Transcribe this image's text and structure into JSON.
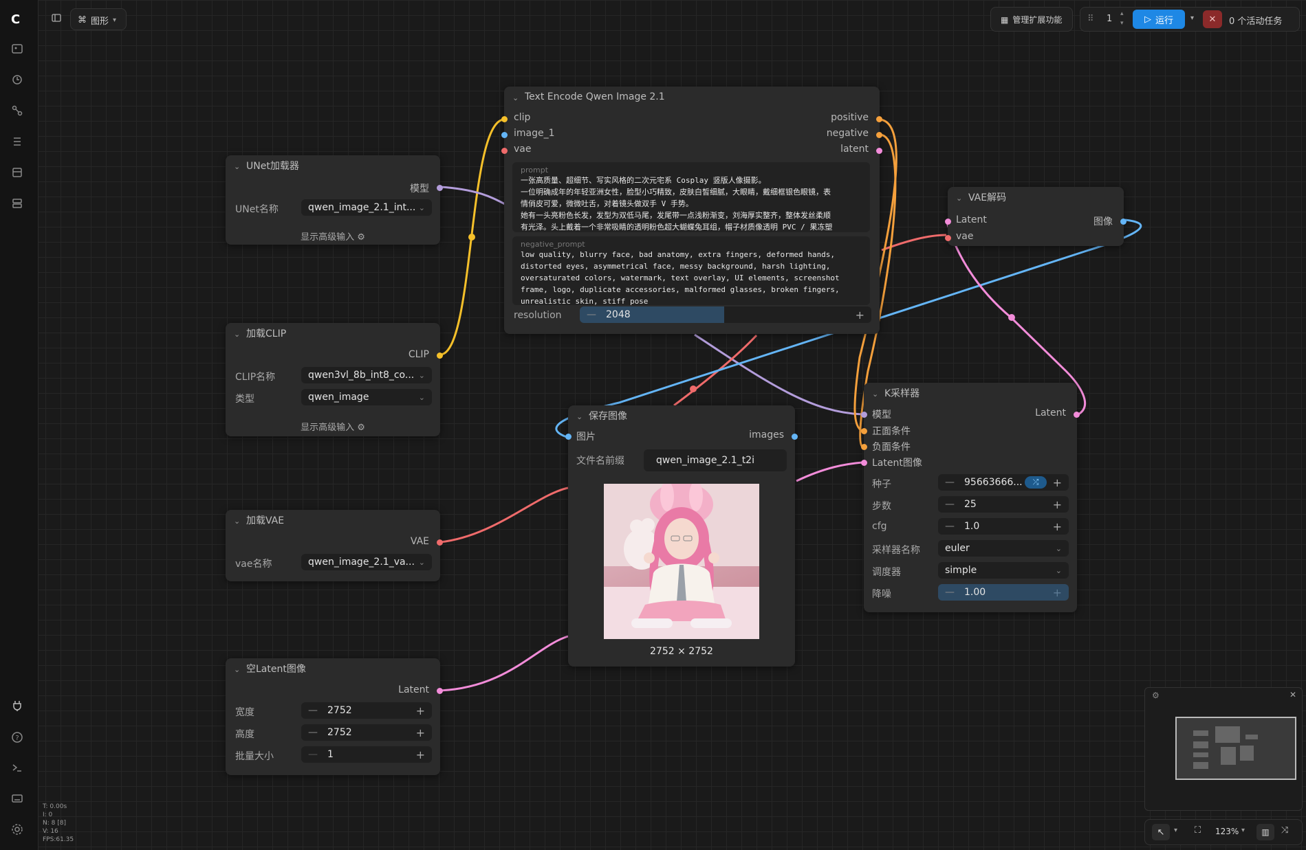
{
  "topbar": {
    "graph_tab": "图形",
    "manage_ext": "管理扩展功能",
    "run_count": "1",
    "run_label": "运行",
    "active_tasks": "0 个活动任务"
  },
  "nodes": {
    "text_encode": {
      "title": "Text Encode Qwen Image 2.1",
      "inputs": [
        "clip",
        "image_1",
        "vae"
      ],
      "outputs": [
        "positive",
        "negative",
        "latent"
      ],
      "prompt_placeholder": "prompt",
      "prompt_lines": [
        "一张高质量、超细节、写实风格的二次元宅系 Cosplay 竖版人像摄影。",
        "一位明确成年的年轻亚洲女性，脸型小巧精致，皮肤白皙细腻，大眼睛，戴细框银色眼镜，表",
        "情俏皮可爱，微微吐舌，对着镜头做双手 V 手势。",
        "她有一头亮粉色长发，发型为双低马尾，发尾带一点浅粉渐变，刘海厚实整齐，整体发丝柔顺",
        "有光泽。头上戴着一个非常吸睛的透明粉色超大蝴蝶兔耳组，帽子材质像透明 PVC / 果冻塑"
      ],
      "negative_placeholder": "negative_prompt",
      "negative_lines": [
        "low quality, blurry face, bad anatomy, extra fingers, deformed hands,",
        "distorted eyes, asymmetrical face, messy background, harsh lighting,",
        "oversaturated colors, watermark, text overlay, UI elements, screenshot",
        "frame, logo, duplicate accessories, malformed glasses, broken fingers,",
        "unrealistic skin, stiff pose"
      ],
      "resolution_label": "resolution",
      "resolution_value": "2048"
    },
    "unet": {
      "title": "UNet加载器",
      "output": "模型",
      "name_label": "UNet名称",
      "name_value": "qwen_image_2.1_int...",
      "advanced": "显示高级输入"
    },
    "clip": {
      "title": "加载CLIP",
      "output": "CLIP",
      "name_label": "CLIP名称",
      "name_value": "qwen3vl_8b_int8_co...",
      "type_label": "类型",
      "type_value": "qwen_image",
      "advanced": "显示高级输入"
    },
    "vae_loader": {
      "title": "加载VAE",
      "output": "VAE",
      "name_label": "vae名称",
      "name_value": "qwen_image_2.1_va..."
    },
    "empty_latent": {
      "title": "空Latent图像",
      "output": "Latent",
      "width_label": "宽度",
      "width_value": "2752",
      "height_label": "高度",
      "height_value": "2752",
      "batch_label": "批量大小",
      "batch_value": "1"
    },
    "save_image": {
      "title": "保存图像",
      "input": "图片",
      "output": "images",
      "prefix_label": "文件名前缀",
      "prefix_value": "qwen_image_2.1_t2i",
      "image_size": "2752 × 2752"
    },
    "vae_decode": {
      "title": "VAE解码",
      "inputs": [
        "Latent",
        "vae"
      ],
      "output": "图像"
    },
    "ksampler": {
      "title": "K采样器",
      "inputs": [
        "模型",
        "正面条件",
        "负面条件",
        "Latent图像"
      ],
      "output": "Latent",
      "seed_label": "种子",
      "seed_value": "95663666...",
      "steps_label": "步数",
      "steps_value": "25",
      "cfg_label": "cfg",
      "cfg_value": "1.0",
      "sampler_label": "采样器名称",
      "sampler_value": "euler",
      "scheduler_label": "调度器",
      "scheduler_value": "simple",
      "denoise_label": "降噪",
      "denoise_value": "1.00"
    }
  },
  "stats": [
    "T: 0.00s",
    "I: 0",
    "N: 8 [8]",
    "V: 16",
    "FPS:61.35"
  ],
  "zoom": "123%",
  "colors": {
    "clip": "#f5c02a",
    "model": "#b39ddb",
    "vae": "#ef6b6b",
    "latent": "#f28cd9",
    "image": "#64b5f6",
    "cond": "#f5a03c",
    "accent": "#1e88e5"
  }
}
